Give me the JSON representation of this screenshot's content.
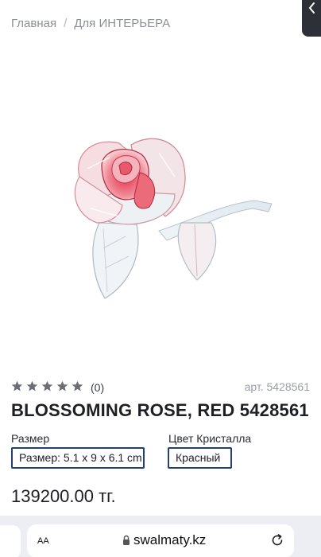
{
  "breadcrumb": {
    "home": "Главная",
    "separator": "/",
    "current": "Для ИНТЕРЬЕРА"
  },
  "product": {
    "image_icon": "crystal-rose-illustration",
    "rating": {
      "stars_total": 5,
      "stars_filled": 0,
      "review_count": "(0)"
    },
    "sku": "арт. 5428561",
    "title": "BLOSSOMING ROSE, RED 5428561",
    "options": {
      "size_label": "Размер",
      "size_value": "Размер: 5.1 x 9 x 6.1 cm",
      "color_label": "Цвет Кристалла",
      "color_value": "Красный"
    },
    "price": "139200.00 тг."
  },
  "browser": {
    "text_size_label": "AA",
    "url": "swalmaty.kz",
    "lock_icon": "lock-icon",
    "reload_icon": "reload-icon"
  },
  "colors": {
    "accent_border": "#23406e",
    "star": "#6b6f75",
    "muted_text": "#8b8f96"
  }
}
